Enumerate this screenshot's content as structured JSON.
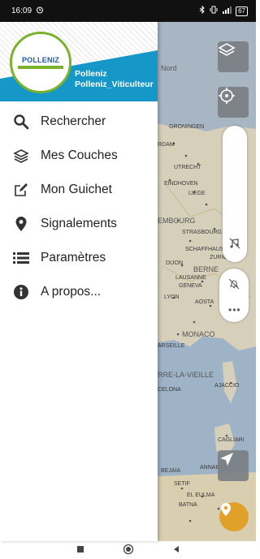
{
  "status_bar": {
    "time": "16:09",
    "alarm_icon": "alarm-clock-icon",
    "bluetooth_icon": "bluetooth-icon",
    "vibrate_icon": "vibrate-icon",
    "signal_icon": "signal-icon",
    "battery": "67"
  },
  "drawer": {
    "logo_text": "POLLENIZ",
    "account_name": "Polleniz",
    "account_role": "Polleniz_Viticulteur",
    "menu": [
      {
        "label": "Rechercher",
        "icon": "search-icon"
      },
      {
        "label": "Mes Couches",
        "icon": "layers-icon"
      },
      {
        "label": "Mon Guichet",
        "icon": "edit-icon"
      },
      {
        "label": "Signalements",
        "icon": "location-pin-icon"
      },
      {
        "label": "Paramètres",
        "icon": "list-icon"
      },
      {
        "label": "A propos...",
        "icon": "info-icon"
      }
    ]
  },
  "map": {
    "labels": [
      "Nord",
      "GRONINGEN",
      "RDAM",
      "UTRECHT",
      "EINDHOVEN",
      "LIEGE",
      "EMBOURG",
      "STRASBOURG",
      "SCHAFFHAUSEN",
      "ZURICH",
      "DIJON",
      "BERNE",
      "LAUSANNE",
      "GENEVA",
      "LYON",
      "AOSTA",
      "MONACO",
      "ARSEILLE",
      "RRE-LA-VIEILLE",
      "AJACCIO",
      "CELONA",
      "CAGLIARI",
      "BEJAIA",
      "ANNABA",
      "SETIF",
      "EL EULMA",
      "BATNA"
    ]
  },
  "nav_bar": {
    "recents_icon": "recents-square-icon",
    "home_icon": "home-circle-icon",
    "back_icon": "back-triangle-icon"
  },
  "colors": {
    "accent": "#1597c8",
    "logo_green": "#7ab22e",
    "fab": "#e0a12b"
  }
}
